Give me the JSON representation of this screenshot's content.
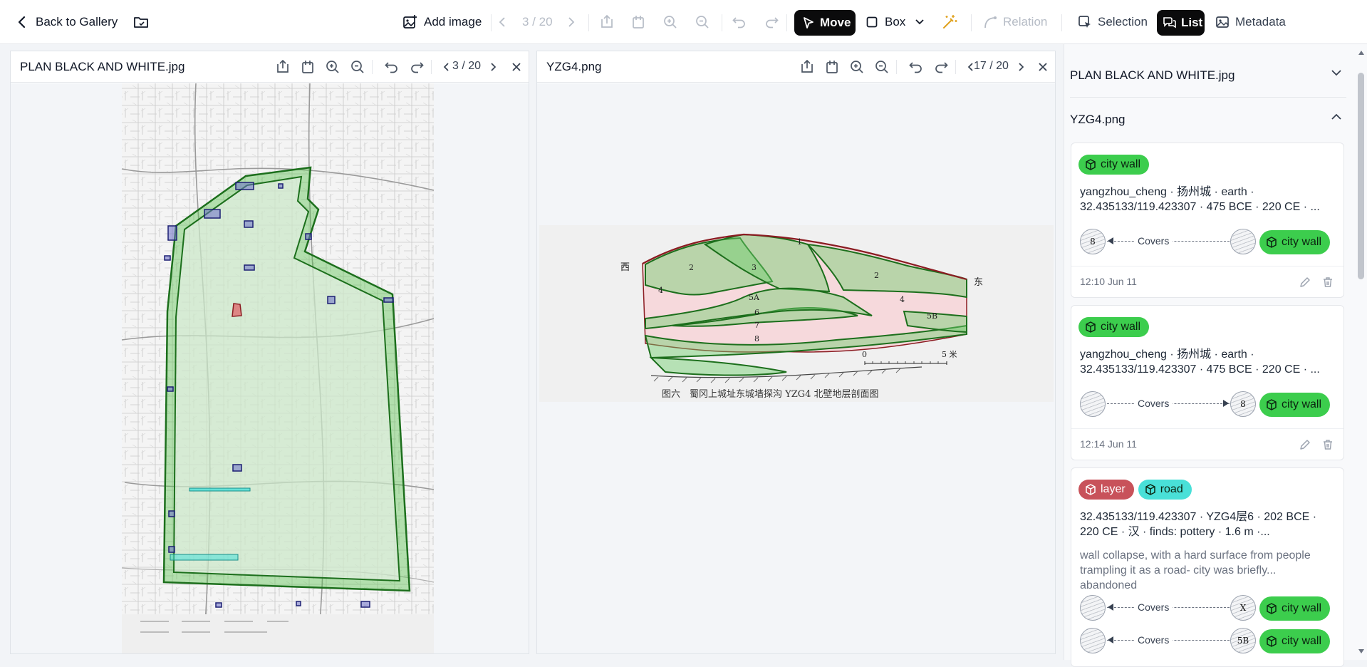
{
  "toolbar": {
    "back_label": "Back to Gallery",
    "add_image_label": "Add image",
    "counter": "3 / 20",
    "move_label": "Move",
    "box_label": "Box",
    "relation_label": "Relation",
    "selection_label": "Selection",
    "list_label": "List",
    "metadata_label": "Metadata"
  },
  "panels": [
    {
      "title": "PLAN BLACK AND WHITE.jpg",
      "counter": "3 / 20"
    },
    {
      "title": "YZG4.png",
      "counter": "17 / 20"
    }
  ],
  "section_image": {
    "caption": "图六　蜀冈上城址东城墙探沟 YZG4 北壁地层剖面图",
    "west_label": "西",
    "east_label": "东",
    "scale_zero": "0",
    "scale_five": "5 米",
    "layer_labels": [
      "1",
      "2",
      "2",
      "3",
      "4",
      "4",
      "5A",
      "5B",
      "6",
      "7",
      "8"
    ]
  },
  "sidebar": {
    "sections": [
      {
        "title": "PLAN BLACK AND WHITE.jpg",
        "expanded": false
      },
      {
        "title": "YZG4.png",
        "expanded": true
      }
    ],
    "cards": [
      {
        "tags": [
          {
            "label": "city wall",
            "color": "#3ccd4d"
          }
        ],
        "text": "yangzhou_cheng · 扬州城 · earth · 32.435133/119.423307 · 475 BCE · 220 CE · ...",
        "relations": [
          {
            "left_thumb": "8",
            "right_thumb": "",
            "label": "Covers",
            "arrow": "left",
            "target": "city wall"
          }
        ],
        "time": "12:10 Jun 11"
      },
      {
        "tags": [
          {
            "label": "city wall",
            "color": "#3ccd4d"
          }
        ],
        "text": "yangzhou_cheng · 扬州城 · earth · 32.435133/119.423307 · 475 BCE · 220 CE · ...",
        "relations": [
          {
            "left_thumb": "",
            "right_thumb": "8",
            "label": "Covers",
            "arrow": "right",
            "target": "city wall"
          }
        ],
        "time": "12:14 Jun 11"
      },
      {
        "tags": [
          {
            "label": "layer",
            "color": "#c8525a"
          },
          {
            "label": "road",
            "color": "#49e0d8"
          }
        ],
        "text": "32.435133/119.423307 · YZG4层6 · 202 BCE · 220 CE · 汉 · finds: pottery · 1.6 m ·...",
        "note": "wall collapse, with a hard surface from people trampling it as a road- city was briefly... abandoned",
        "relations": [
          {
            "left_thumb": "",
            "right_thumb": "X",
            "label": "Covers",
            "arrow": "left",
            "target": "city wall"
          },
          {
            "left_thumb": "",
            "right_thumb": "5B",
            "label": "Covers",
            "arrow": "left",
            "target": "city wall"
          }
        ]
      }
    ]
  }
}
